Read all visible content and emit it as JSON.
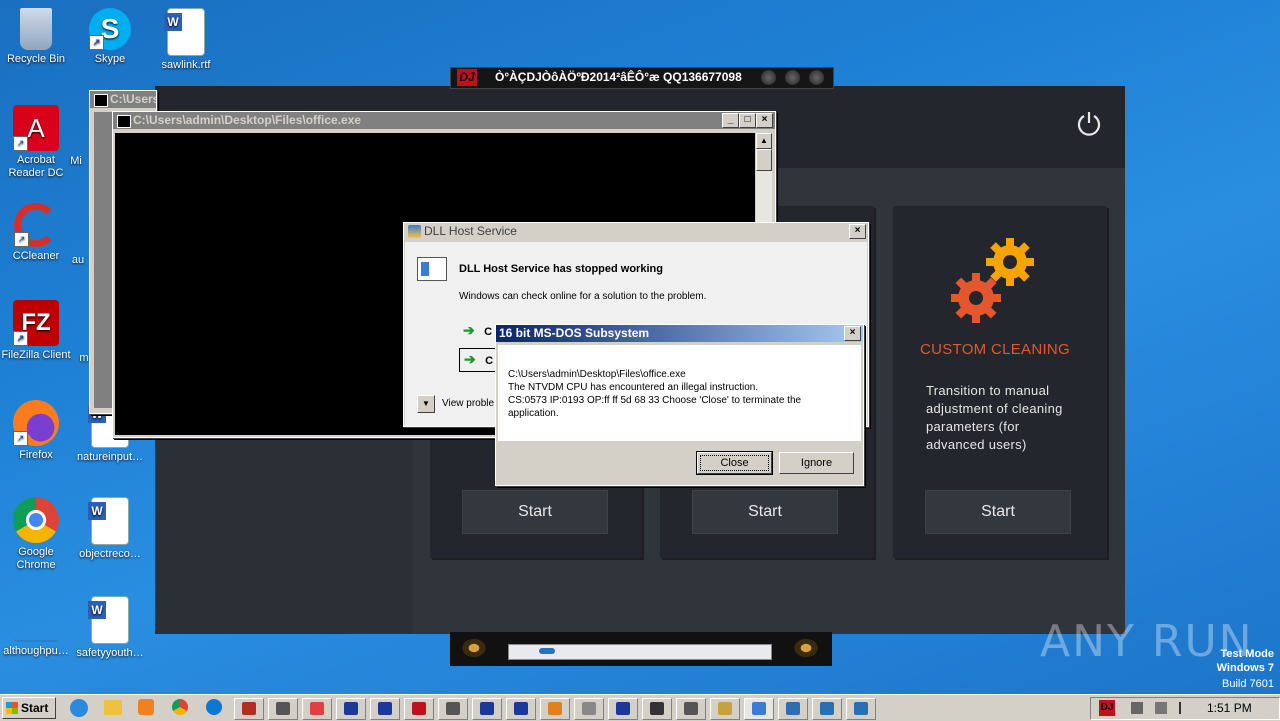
{
  "desktop_icons": [
    {
      "label": "Recycle Bin",
      "icon": "recycle-bin-icon",
      "color": "#9fb7d6"
    },
    {
      "label": "Skype",
      "icon": "skype-icon",
      "color": "#00aff0"
    },
    {
      "label": "sawlink.rtf",
      "icon": "word-document-icon",
      "color": "#2b5fb8"
    },
    {
      "label": "Acrobat Reader DC",
      "icon": "acrobat-icon",
      "color": "#d9001b"
    },
    {
      "label": "Mi",
      "icon": "partial-icon",
      "color": "#4a7bd0"
    },
    {
      "label": "CCleaner",
      "icon": "ccleaner-icon",
      "color": "#d4302b"
    },
    {
      "label": "au",
      "icon": "partial-icon",
      "color": "#4a7bd0"
    },
    {
      "label": "FileZilla Client",
      "icon": "filezilla-icon",
      "color": "#bf0000"
    },
    {
      "label": "m",
      "icon": "partial-icon",
      "color": "#4a7bd0"
    },
    {
      "label": "Firefox",
      "icon": "firefox-icon",
      "color": "#ff7b1c"
    },
    {
      "label": "natureinput…",
      "icon": "word-document-icon",
      "color": "#2b5fb8"
    },
    {
      "label": "Google Chrome",
      "icon": "chrome-icon",
      "color": "#db4437"
    },
    {
      "label": "objectreco…",
      "icon": "word-document-icon",
      "color": "#2b5fb8"
    },
    {
      "label": "althoughpu…",
      "icon": "blank-file-icon",
      "color": "#2a80d0"
    },
    {
      "label": "safetyyouth…",
      "icon": "word-document-icon",
      "color": "#2b5fb8"
    }
  ],
  "player": {
    "title": "Ò°ÀÇDJÒôÀÖºÐ2014²âÊÔ°æ QQ136677098",
    "logo": "DJ"
  },
  "cleaner_app": {
    "cards": [
      {
        "title": "",
        "description": "",
        "button": "Start"
      },
      {
        "title": "",
        "description": "",
        "button": "Start"
      },
      {
        "title": "CUSTOM CLEANING",
        "description": "Transition to manual adjustment of cleaning parameters (for advanced users)",
        "button": "Start"
      }
    ],
    "accent": "#e4572e"
  },
  "back_console": {
    "title": "C:\\Users"
  },
  "console": {
    "title": "C:\\Users\\admin\\Desktop\\Files\\office.exe"
  },
  "dll_dialog": {
    "title": "DLL Host Service",
    "heading": "DLL Host Service has stopped working",
    "message": "Windows can check online for a solution to the problem.",
    "option1": "C",
    "option2": "C",
    "details": "View proble"
  },
  "msdos_dialog": {
    "title": "16 bit MS-DOS Subsystem",
    "line1": "C:\\Users\\admin\\Desktop\\Files\\office.exe",
    "line2": "The NTVDM CPU has encountered an illegal instruction.",
    "line3": "CS:0573 IP:0193 OP:ff ff 5d 68 33 Choose 'Close' to terminate the",
    "line4": "application.",
    "close_label": "Close",
    "ignore_label": "Ignore"
  },
  "watermark": {
    "brand": "ANY RUN",
    "mode": "Test Mode",
    "os": "Windows 7",
    "build": "Build 7601"
  },
  "taskbar": {
    "start_label": "Start",
    "clock": "1:51 PM",
    "tray_logo": "DJ"
  }
}
